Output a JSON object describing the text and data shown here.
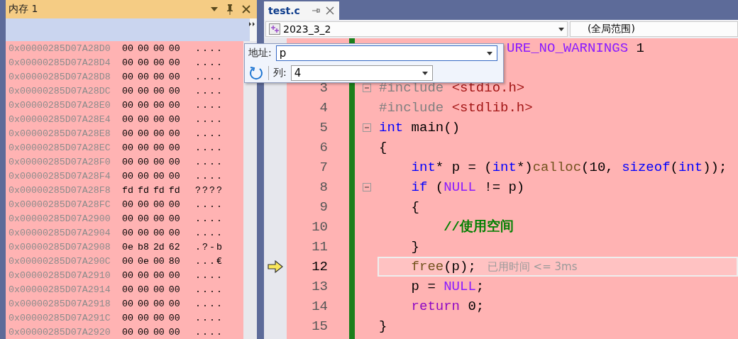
{
  "memory_window": {
    "title": "内存 1",
    "rows": [
      {
        "address": "0x00000285D07A28D0",
        "bytes": "00 00 00 00",
        "chars": "...."
      },
      {
        "address": "0x00000285D07A28D4",
        "bytes": "00 00 00 00",
        "chars": "...."
      },
      {
        "address": "0x00000285D07A28D8",
        "bytes": "00 00 00 00",
        "chars": "...."
      },
      {
        "address": "0x00000285D07A28DC",
        "bytes": "00 00 00 00",
        "chars": "...."
      },
      {
        "address": "0x00000285D07A28E0",
        "bytes": "00 00 00 00",
        "chars": "...."
      },
      {
        "address": "0x00000285D07A28E4",
        "bytes": "00 00 00 00",
        "chars": "...."
      },
      {
        "address": "0x00000285D07A28E8",
        "bytes": "00 00 00 00",
        "chars": "...."
      },
      {
        "address": "0x00000285D07A28EC",
        "bytes": "00 00 00 00",
        "chars": "...."
      },
      {
        "address": "0x00000285D07A28F0",
        "bytes": "00 00 00 00",
        "chars": "...."
      },
      {
        "address": "0x00000285D07A28F4",
        "bytes": "00 00 00 00",
        "chars": "...."
      },
      {
        "address": "0x00000285D07A28F8",
        "bytes": "fd fd fd fd",
        "chars": "????"
      },
      {
        "address": "0x00000285D07A28FC",
        "bytes": "00 00 00 00",
        "chars": "...."
      },
      {
        "address": "0x00000285D07A2900",
        "bytes": "00 00 00 00",
        "chars": "...."
      },
      {
        "address": "0x00000285D07A2904",
        "bytes": "00 00 00 00",
        "chars": "...."
      },
      {
        "address": "0x00000285D07A2908",
        "bytes": "0e b8 2d 62",
        "chars": ".?-b"
      },
      {
        "address": "0x00000285D07A290C",
        "bytes": "00 0e 00 80",
        "chars": "...€"
      },
      {
        "address": "0x00000285D07A2910",
        "bytes": "00 00 00 00",
        "chars": "...."
      },
      {
        "address": "0x00000285D07A2914",
        "bytes": "00 00 00 00",
        "chars": "...."
      },
      {
        "address": "0x00000285D07A2918",
        "bytes": "00 00 00 00",
        "chars": "...."
      },
      {
        "address": "0x00000285D07A291C",
        "bytes": "00 00 00 00",
        "chars": "...."
      },
      {
        "address": "0x00000285D07A2920",
        "bytes": "00 00 00 00",
        "chars": "...."
      }
    ]
  },
  "editor": {
    "tab": {
      "title": "test.c",
      "selected": true
    },
    "project_dropdown": "2023_3_2",
    "scope_dropdown": "(全局范围)",
    "lines": [
      {
        "fold": false,
        "current": false,
        "tokens": [
          {
            "kind": "macro",
            "text": "URE_NO_WARNINGS"
          },
          {
            "kind": "plain",
            "text": " 1"
          }
        ]
      },
      {
        "number": "3",
        "fold": true,
        "current": false,
        "tokens": [
          {
            "kind": "preproc",
            "text": "#include "
          },
          {
            "kind": "string",
            "text": "<stdio.h>"
          }
        ]
      },
      {
        "number": "4",
        "fold": false,
        "current": false,
        "tokens": [
          {
            "kind": "preproc",
            "text": "#include "
          },
          {
            "kind": "string",
            "text": "<stdlib.h>"
          }
        ]
      },
      {
        "number": "5",
        "fold": true,
        "current": false,
        "tokens": [
          {
            "kind": "keyword",
            "text": "int"
          },
          {
            "kind": "plain",
            "text": " main()"
          }
        ]
      },
      {
        "number": "6",
        "fold": false,
        "current": false,
        "tokens": [
          {
            "kind": "plain",
            "text": "{"
          }
        ]
      },
      {
        "number": "7",
        "fold": false,
        "current": false,
        "tokens": [
          {
            "kind": "keyword",
            "text": "    int"
          },
          {
            "kind": "plain",
            "text": "* p = ("
          },
          {
            "kind": "keyword",
            "text": "int"
          },
          {
            "kind": "plain",
            "text": "*)"
          },
          {
            "kind": "function",
            "text": "calloc"
          },
          {
            "kind": "plain",
            "text": "(10, "
          },
          {
            "kind": "keyword",
            "text": "sizeof"
          },
          {
            "kind": "plain",
            "text": "("
          },
          {
            "kind": "keyword",
            "text": "int"
          },
          {
            "kind": "plain",
            "text": "));"
          }
        ]
      },
      {
        "number": "8",
        "fold": true,
        "current": false,
        "tokens": [
          {
            "kind": "keyword",
            "text": "    if"
          },
          {
            "kind": "plain",
            "text": " ("
          },
          {
            "kind": "macro",
            "text": "NULL"
          },
          {
            "kind": "plain",
            "text": " != p)"
          }
        ]
      },
      {
        "number": "9",
        "fold": false,
        "current": false,
        "tokens": [
          {
            "kind": "plain",
            "text": "    {"
          }
        ]
      },
      {
        "number": "10",
        "fold": false,
        "current": false,
        "tokens": [
          {
            "kind": "comment",
            "text": "        //使用空间"
          }
        ]
      },
      {
        "number": "11",
        "fold": false,
        "current": false,
        "tokens": [
          {
            "kind": "plain",
            "text": "    }"
          }
        ]
      },
      {
        "number": "12",
        "fold": false,
        "current": true,
        "tokens": [
          {
            "kind": "function",
            "text": "    free"
          },
          {
            "kind": "plain",
            "text": "(p);"
          }
        ],
        "hint": "已用时间 <= 3ms"
      },
      {
        "number": "13",
        "fold": false,
        "current": false,
        "tokens": [
          {
            "kind": "plain",
            "text": "    p = "
          },
          {
            "kind": "macro",
            "text": "NULL"
          },
          {
            "kind": "plain",
            "text": ";"
          }
        ]
      },
      {
        "number": "14",
        "fold": false,
        "current": false,
        "tokens": [
          {
            "kind": "control",
            "text": "    return"
          },
          {
            "kind": "plain",
            "text": " 0;"
          }
        ]
      },
      {
        "number": "15",
        "fold": false,
        "current": false,
        "tokens": [
          {
            "kind": "plain",
            "text": "}"
          }
        ]
      }
    ]
  },
  "address_popup": {
    "address_label": "地址:",
    "address_value": "p",
    "columns_label": "列:",
    "columns_value": "4"
  }
}
